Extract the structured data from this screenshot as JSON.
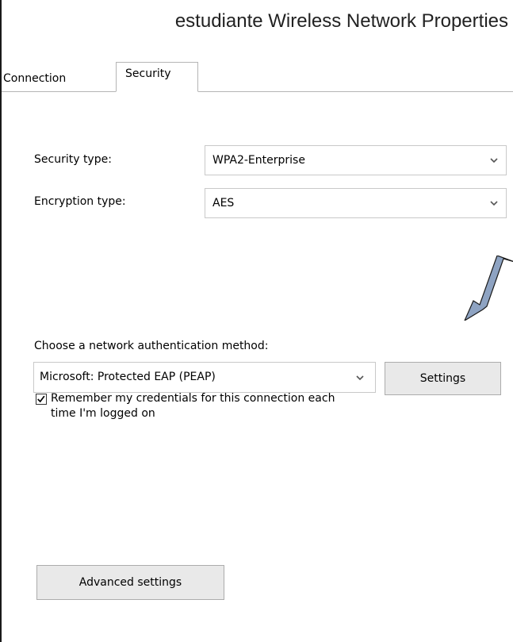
{
  "window": {
    "title": "estudiante Wireless Network Properties"
  },
  "tabs": [
    {
      "label": "Connection",
      "selected": false
    },
    {
      "label": "Security",
      "selected": true
    }
  ],
  "security": {
    "security_type_label": "Security type:",
    "security_type_value": "WPA2-Enterprise",
    "encryption_type_label": "Encryption type:",
    "encryption_type_value": "AES",
    "auth_method_label": "Choose a network authentication method:",
    "auth_method_value": "Microsoft: Protected EAP (PEAP)",
    "settings_label": "Settings",
    "remember_line1": "Remember my credentials for this connection each",
    "remember_line2": "time I'm logged on",
    "remember_checked": true,
    "advanced_label": "Advanced settings"
  },
  "colors": {
    "arrow_fill": "#8ea3c2",
    "button_face": "#e9e9e9"
  },
  "icons": [
    "chevron-down-icon",
    "checkmark-icon",
    "arrow-pointer"
  ]
}
